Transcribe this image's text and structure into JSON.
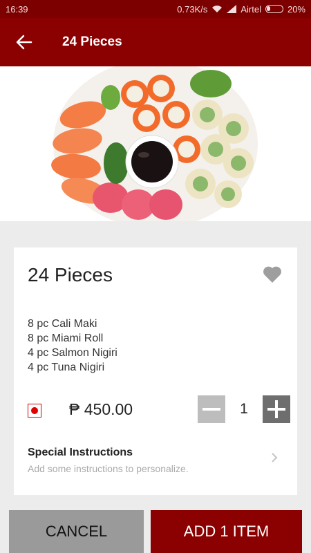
{
  "status_bar": {
    "time": "16:39",
    "network_speed": "0.73K/s",
    "carrier": "Airtel",
    "battery": "20%"
  },
  "app_bar": {
    "title": "24 Pieces",
    "back_icon": "arrow-left-icon"
  },
  "item": {
    "title": "24 Pieces",
    "favorite_icon": "heart-icon",
    "description": [
      "8 pc Cali Maki",
      "8 pc Miami Roll",
      "4 pc Salmon Nigiri",
      "4 pc Tuna Nigiri"
    ],
    "currency_symbol": "₱",
    "price": "₱ 450.00",
    "quantity": "1"
  },
  "special_instructions": {
    "title": "Special Instructions",
    "subtitle": "Add some instructions to personalize."
  },
  "buttons": {
    "cancel": "CANCEL",
    "add": "ADD 1 ITEM"
  },
  "colors": {
    "brand": "#8b0000",
    "status_bar": "#7d0000",
    "cancel": "#9a9a9a",
    "minus": "#bdbdbd",
    "plus": "#6e6e6e"
  }
}
